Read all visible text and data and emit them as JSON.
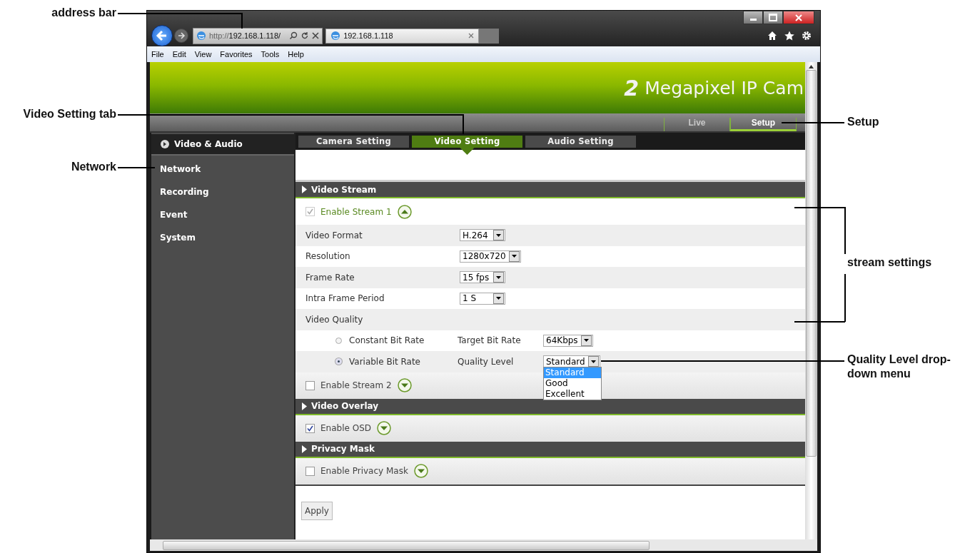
{
  "callouts": [
    {
      "text": "address bar"
    },
    {
      "text": "Video Setting tab"
    },
    {
      "text": "Network"
    },
    {
      "text": "Setup"
    },
    {
      "text": "stream settings"
    },
    {
      "text": "Quality Level drop-down menu"
    }
  ],
  "browser": {
    "address_scheme": "http://",
    "address_host": "192.168.1.118/",
    "tab_title": "192.168.1.118",
    "menu": [
      "File",
      "Edit",
      "View",
      "Favorites",
      "Tools",
      "Help"
    ]
  },
  "banner": {
    "logo": "2",
    "title": "Megapixel IP Cam"
  },
  "nav_tabs": [
    {
      "label": "Live",
      "selected": false
    },
    {
      "label": "Setup",
      "selected": true
    }
  ],
  "sidebar": [
    {
      "label": "Video & Audio",
      "selected": true
    },
    {
      "label": "Network",
      "selected": false
    },
    {
      "label": "Recording",
      "selected": false
    },
    {
      "label": "Event",
      "selected": false
    },
    {
      "label": "System",
      "selected": false
    }
  ],
  "tabs": [
    {
      "label": "Camera Setting",
      "selected": false
    },
    {
      "label": "Video Setting",
      "selected": true
    },
    {
      "label": "Audio Setting",
      "selected": false
    }
  ],
  "sections": [
    {
      "title": "Video Stream",
      "items": [
        {
          "kind": "toggle",
          "label": "Enable Stream 1",
          "checked": true,
          "disabled": true,
          "expanded": true
        },
        {
          "kind": "select",
          "label": "Video Format",
          "value": "H.264"
        },
        {
          "kind": "select",
          "label": "Resolution",
          "value": "1280x720"
        },
        {
          "kind": "select",
          "label": "Frame Rate",
          "value": "15 fps"
        },
        {
          "kind": "select",
          "label": "Intra Frame Period",
          "value": "1 S"
        },
        {
          "kind": "heading",
          "label": "Video Quality"
        },
        {
          "kind": "radio",
          "label": "Constant Bit Rate",
          "selected": false,
          "field_label": "Target Bit Rate",
          "value": "64Kbps"
        },
        {
          "kind": "radio",
          "label": "Variable Bit Rate",
          "selected": true,
          "field_label": "Quality Level",
          "value": "Standard",
          "open_options": [
            {
              "label": "Standard",
              "selected": true
            },
            {
              "label": "Good",
              "selected": false
            },
            {
              "label": "Excellent",
              "selected": false
            }
          ]
        },
        {
          "kind": "toggle",
          "label": "Enable Stream 2",
          "checked": false,
          "disabled": false,
          "expanded": false
        }
      ]
    },
    {
      "title": "Video Overlay",
      "items": [
        {
          "kind": "toggle",
          "label": "Enable OSD",
          "checked": true,
          "disabled": false,
          "expanded": false
        }
      ]
    },
    {
      "title": "Privacy Mask",
      "items": [
        {
          "kind": "toggle",
          "label": "Enable Privacy Mask",
          "checked": false,
          "disabled": false,
          "expanded": false
        }
      ]
    }
  ],
  "apply": "Apply"
}
